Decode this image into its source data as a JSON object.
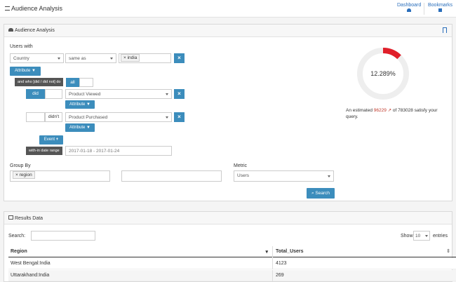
{
  "header": {
    "title": "Audience Analysis",
    "nav": [
      {
        "label": "Dashboard",
        "icon": "dashboard-icon"
      },
      {
        "label": "Bookmarks",
        "icon": "bookmark-icon"
      }
    ]
  },
  "panel": {
    "title": "Audience Analysis",
    "users_with_label": "Users with",
    "filter": {
      "field": "Country",
      "operator": "same as",
      "value": "india"
    },
    "attribute_label": "Attribute",
    "who_label": "and who [did / did not] do",
    "toggle_all": "all",
    "did_label": "did",
    "didnt_label": "didn't",
    "event1": "Product Viewed",
    "event2": "Product Purchased",
    "event_button": "Event",
    "date_label": "with-in date range",
    "date_value": "2017-01-18 - 2017-01-24",
    "group_by_label": "Group By",
    "group_by_tag": "region",
    "metric_label": "Metric",
    "metric_value": "Users",
    "search_button": "Search",
    "gauge": {
      "percent_text": "12.289%",
      "fraction": 0.12289,
      "color": "#e01f2a",
      "track": "#eeeeee"
    },
    "estimate_prefix": "An estimated",
    "estimate_count": "96229",
    "estimate_mid": "of 783028 satisfy your query."
  },
  "results": {
    "title": "Results Data",
    "search_label": "Search:",
    "show_label": "Show",
    "show_value": "10",
    "entries_label": "entries",
    "columns": [
      "Region",
      "Total_Users"
    ],
    "rows": [
      {
        "region": "West Bengal:India",
        "total": "4123"
      },
      {
        "region": "Uttarakhand:India",
        "total": "269"
      }
    ]
  }
}
